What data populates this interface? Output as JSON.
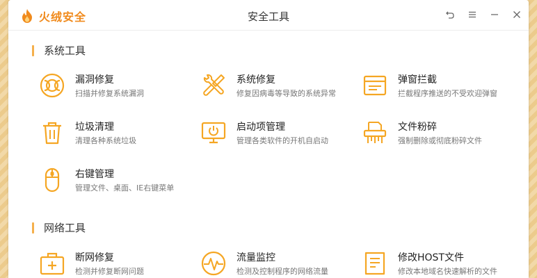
{
  "app": {
    "name": "火绒安全",
    "title": "安全工具"
  },
  "colors": {
    "accent": "#f5a623",
    "brand": "#f08a1c"
  },
  "sections": [
    {
      "title": "系统工具",
      "tools": [
        {
          "icon": "lifebuoy-icon",
          "title": "漏洞修复",
          "desc": "扫描并修复系统漏洞"
        },
        {
          "icon": "wrench-screwdriver-icon",
          "title": "系统修复",
          "desc": "修复因病毒等导致的系统异常"
        },
        {
          "icon": "popup-window-icon",
          "title": "弹窗拦截",
          "desc": "拦截程序推送的不受欢迎弹窗"
        },
        {
          "icon": "trash-icon",
          "title": "垃圾清理",
          "desc": "清理各种系统垃圾"
        },
        {
          "icon": "monitor-power-icon",
          "title": "启动项管理",
          "desc": "管理各类软件的开机自启动"
        },
        {
          "icon": "shredder-icon",
          "title": "文件粉碎",
          "desc": "强制删除或彻底粉碎文件"
        },
        {
          "icon": "mouse-icon",
          "title": "右键管理",
          "desc": "管理文件、桌面、IE右键菜单"
        }
      ]
    },
    {
      "title": "网络工具",
      "tools": [
        {
          "icon": "network-kit-icon",
          "title": "断网修复",
          "desc": "检测并修复断网问题"
        },
        {
          "icon": "traffic-monitor-icon",
          "title": "流量监控",
          "desc": "检测及控制程序的网络流量"
        },
        {
          "icon": "host-file-icon",
          "title": "修改HOST文件",
          "desc": "修改本地域名快速解析的文件"
        }
      ]
    }
  ]
}
